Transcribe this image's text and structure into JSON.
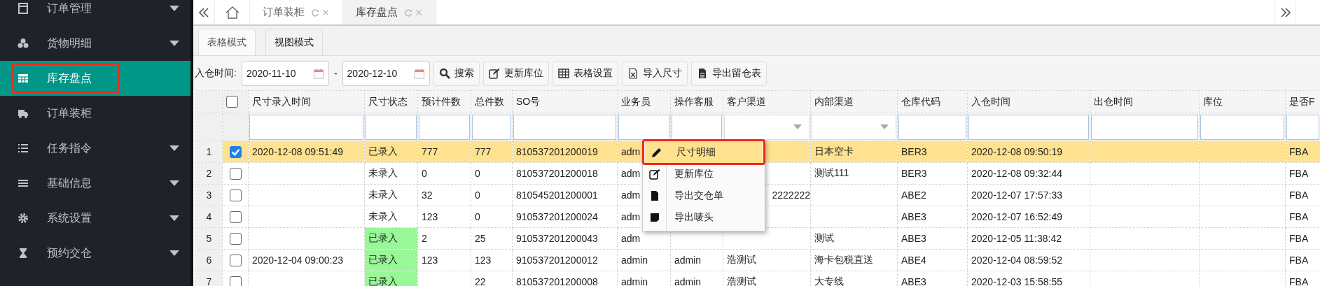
{
  "sidebar": {
    "items": [
      {
        "label": "订单管理",
        "expandable": true,
        "selected": false,
        "annotated": false
      },
      {
        "label": "货物明细",
        "expandable": true,
        "selected": false,
        "annotated": false
      },
      {
        "label": "库存盘点",
        "expandable": false,
        "selected": true,
        "annotated": true
      },
      {
        "label": "订单装柜",
        "expandable": false,
        "selected": false,
        "annotated": false
      },
      {
        "label": "任务指令",
        "expandable": true,
        "selected": false,
        "annotated": false
      },
      {
        "label": "基础信息",
        "expandable": true,
        "selected": false,
        "annotated": false
      },
      {
        "label": "系统设置",
        "expandable": true,
        "selected": false,
        "annotated": false
      },
      {
        "label": "预约交仓",
        "expandable": true,
        "selected": false,
        "annotated": false
      }
    ]
  },
  "page_tabs": [
    {
      "label": "订单装柜",
      "selected": false
    },
    {
      "label": "库存盘点",
      "selected": true
    }
  ],
  "view_tabs": [
    {
      "label": "表格模式",
      "selected": true
    },
    {
      "label": "视图模式",
      "selected": false
    }
  ],
  "filter": {
    "label": "入仓时间:",
    "date_from": "2020-11-10",
    "separator": "-",
    "date_to": "2020-12-10"
  },
  "toolbar_buttons": [
    {
      "label": "搜索"
    },
    {
      "label": "更新库位"
    },
    {
      "label": "表格设置"
    },
    {
      "label": "导入尺寸"
    },
    {
      "label": "导出留仓表"
    }
  ],
  "table": {
    "all_checked": false,
    "columns": [
      {
        "label": "尺寸录入时间",
        "kind": "input"
      },
      {
        "label": "尺寸状态",
        "kind": "input"
      },
      {
        "label": "预计件数",
        "kind": "input"
      },
      {
        "label": "总件数",
        "kind": "input"
      },
      {
        "label": "SO号",
        "kind": "input"
      },
      {
        "label": "业务员",
        "kind": "input"
      },
      {
        "label": "操作客服",
        "kind": "input"
      },
      {
        "label": "客户渠道",
        "kind": "select"
      },
      {
        "label": "内部渠道",
        "kind": "select"
      },
      {
        "label": "仓库代码",
        "kind": "input"
      },
      {
        "label": "入仓时间",
        "kind": "input"
      },
      {
        "label": "出仓时间",
        "kind": "input"
      },
      {
        "label": "库位",
        "kind": "input"
      },
      {
        "label": "是否F",
        "kind": "input"
      }
    ],
    "rows": [
      {
        "number": "1",
        "checked": true,
        "selected": true,
        "status_highlight": false,
        "cells": [
          "2020-12-08 09:51:49",
          "已录入",
          "777",
          "777",
          "810537201200019",
          "adm",
          "",
          "",
          "日本空卡",
          "BER3",
          "2020-12-08 09:50:19",
          "",
          "",
          "FBA"
        ]
      },
      {
        "number": "2",
        "checked": false,
        "selected": false,
        "status_highlight": false,
        "cells": [
          "",
          "未录入",
          "0",
          "0",
          "810537201200018",
          "adm",
          "",
          "",
          "测试111",
          "BER3",
          "2020-12-08 09:32:44",
          "",
          "",
          "FBA"
        ]
      },
      {
        "number": "3",
        "checked": false,
        "selected": false,
        "status_highlight": false,
        "cells": [
          "",
          "未录入",
          "32",
          "0",
          "810545201200001",
          "adm",
          "",
          "2222222",
          "",
          "ABE2",
          "2020-12-07 17:57:33",
          "",
          "",
          "FBA"
        ]
      },
      {
        "number": "4",
        "checked": false,
        "selected": false,
        "status_highlight": false,
        "cells": [
          "",
          "未录入",
          "123",
          "0",
          "910537201200024",
          "adm",
          "",
          "",
          "",
          "ABE3",
          "2020-12-07 16:52:49",
          "",
          "",
          "FBA"
        ]
      },
      {
        "number": "5",
        "checked": false,
        "selected": false,
        "status_highlight": true,
        "cells": [
          "",
          "已录入",
          "2",
          "25",
          "910537201200043",
          "adm",
          "",
          "",
          "测试",
          "ABE3",
          "2020-12-05 11:38:42",
          "",
          "",
          "FBA"
        ]
      },
      {
        "number": "6",
        "checked": false,
        "selected": false,
        "status_highlight": true,
        "cells": [
          "2020-12-04 09:00:23",
          "已录入",
          "123",
          "123",
          "910537201200012",
          "admin",
          "admin",
          "浩测试",
          "海卡包税直送",
          "ABE4",
          "2020-12-04 08:59:52",
          "",
          "",
          "FBA"
        ]
      },
      {
        "number": "7",
        "checked": false,
        "selected": false,
        "status_highlight": true,
        "cells": [
          "",
          "已录入",
          "",
          "22",
          "810537201200008",
          "admin",
          "admin",
          "浩测试",
          "大专线",
          "ABE3",
          "2020-12-03 15:58:55",
          "",
          "",
          "FBA"
        ]
      }
    ]
  },
  "context_menu": {
    "items": [
      {
        "label": "尺寸明细",
        "selected": true,
        "annotated": true
      },
      {
        "label": "更新库位",
        "selected": false,
        "annotated": false
      },
      {
        "label": "导出交仓单",
        "selected": false,
        "annotated": false
      },
      {
        "label": "导出唛头",
        "selected": false,
        "annotated": false
      }
    ]
  }
}
